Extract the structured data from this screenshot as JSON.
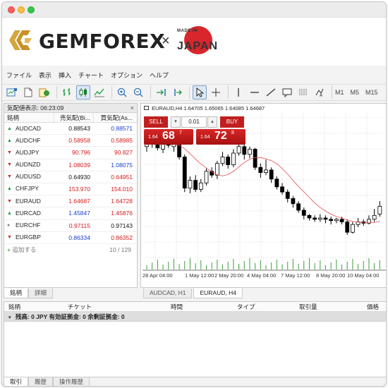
{
  "brand": {
    "name": "GEMFOREX",
    "times": "×",
    "made_in": "MADE IN",
    "country": "JAPAN"
  },
  "menu": [
    "ファイル",
    "表示",
    "挿入",
    "チャート",
    "オプション",
    "ヘルプ"
  ],
  "toolbar": {
    "timeframes": [
      "M1",
      "M5",
      "M15"
    ]
  },
  "market_watch": {
    "title": "気配値表示: 06:23:09",
    "close": "×",
    "headers": {
      "symbol": "銘柄",
      "bid": "売気配(Bi...",
      "ask": "買気配(As..."
    },
    "rows": [
      {
        "symbol": "AUDCAD",
        "dir": "up",
        "bid": "0.88543",
        "ask": "0.88571",
        "bid_color": "black",
        "ask_color": "blue"
      },
      {
        "symbol": "AUDCHF",
        "dir": "up",
        "bid": "0.58958",
        "ask": "0.58985",
        "bid_color": "red",
        "ask_color": "red"
      },
      {
        "symbol": "AUDJPY",
        "dir": "down",
        "bid": "90.796",
        "ask": "90.827",
        "bid_color": "red",
        "ask_color": "red"
      },
      {
        "symbol": "AUDNZD",
        "dir": "down",
        "bid": "1.08039",
        "ask": "1.08075",
        "bid_color": "red",
        "ask_color": "blue"
      },
      {
        "symbol": "AUDUSD",
        "dir": "down",
        "bid": "0.64930",
        "ask": "0.64951",
        "bid_color": "black",
        "ask_color": "red"
      },
      {
        "symbol": "CHFJPY",
        "dir": "up",
        "bid": "153.970",
        "ask": "154.010",
        "bid_color": "red",
        "ask_color": "red"
      },
      {
        "symbol": "EURAUD",
        "dir": "down",
        "bid": "1.64687",
        "ask": "1.64728",
        "bid_color": "red",
        "ask_color": "red"
      },
      {
        "symbol": "EURCAD",
        "dir": "up",
        "bid": "1.45847",
        "ask": "1.45876",
        "bid_color": "blue",
        "ask_color": "red"
      },
      {
        "symbol": "EURCHF",
        "dir": "flat",
        "bid": "0.97115",
        "ask": "0.97143",
        "bid_color": "red",
        "ask_color": "black"
      },
      {
        "symbol": "EURGBP",
        "dir": "down",
        "bid": "0.86334",
        "ask": "0.86352",
        "bid_color": "blue",
        "ask_color": "red"
      }
    ],
    "footer": {
      "add": "追加する",
      "count": "10 / 129"
    },
    "tabs": [
      "銘柄",
      "詳細"
    ]
  },
  "chart": {
    "header": "EURAUD,H4  1.64705 1.65065 1.64085 1.64687",
    "one_click": {
      "sell_label": "SELL",
      "buy_label": "BUY",
      "lot": "0.01",
      "sell_small": "1.64",
      "sell_big": "68",
      "sell_sup": "7",
      "buy_small": "1.64",
      "buy_big": "72",
      "buy_sup": "8"
    },
    "xlabels": [
      "28 Apr 04:00",
      "1 May 12:00",
      "2 May 20:00",
      "4 May 04:00",
      "7 May 12:00",
      "8 May 20:00",
      "10 May 04:00"
    ],
    "tabs": [
      "AUDCAD, H1",
      "EURAUD, H4"
    ]
  },
  "chart_data": {
    "type": "candlestick",
    "title": "EURAUD,H4",
    "xlabel": "",
    "ylabel": "",
    "x_ticks": [
      "28 Apr 04:00",
      "1 May 12:00",
      "2 May 20:00",
      "4 May 04:00",
      "7 May 12:00",
      "8 May 20:00",
      "10 May 04:00"
    ],
    "note": "values are relative price levels (0 = chart low, 100 = chart high)",
    "candles": [
      {
        "o": 80,
        "c": 84,
        "h": 88,
        "l": 76,
        "bull": true
      },
      {
        "o": 84,
        "c": 82,
        "h": 86,
        "l": 79,
        "bull": false
      },
      {
        "o": 82,
        "c": 79,
        "h": 85,
        "l": 77,
        "bull": false
      },
      {
        "o": 78,
        "c": 84,
        "h": 87,
        "l": 75,
        "bull": true
      },
      {
        "o": 84,
        "c": 81,
        "h": 88,
        "l": 79,
        "bull": false
      },
      {
        "o": 80,
        "c": 82,
        "h": 84,
        "l": 76,
        "bull": true
      },
      {
        "o": 82,
        "c": 72,
        "h": 84,
        "l": 70,
        "bull": false
      },
      {
        "o": 72,
        "c": 48,
        "h": 74,
        "l": 45,
        "bull": false
      },
      {
        "o": 48,
        "c": 54,
        "h": 57,
        "l": 44,
        "bull": true
      },
      {
        "o": 54,
        "c": 47,
        "h": 58,
        "l": 45,
        "bull": false
      },
      {
        "o": 47,
        "c": 52,
        "h": 55,
        "l": 45,
        "bull": true
      },
      {
        "o": 52,
        "c": 61,
        "h": 63,
        "l": 50,
        "bull": true
      },
      {
        "o": 61,
        "c": 58,
        "h": 64,
        "l": 56,
        "bull": false
      },
      {
        "o": 58,
        "c": 67,
        "h": 69,
        "l": 55,
        "bull": true
      },
      {
        "o": 67,
        "c": 72,
        "h": 76,
        "l": 65,
        "bull": true
      },
      {
        "o": 72,
        "c": 66,
        "h": 74,
        "l": 63,
        "bull": false
      },
      {
        "o": 66,
        "c": 75,
        "h": 78,
        "l": 64,
        "bull": true
      },
      {
        "o": 75,
        "c": 80,
        "h": 85,
        "l": 73,
        "bull": true
      },
      {
        "o": 80,
        "c": 74,
        "h": 82,
        "l": 70,
        "bull": false
      },
      {
        "o": 74,
        "c": 78,
        "h": 80,
        "l": 71,
        "bull": true
      },
      {
        "o": 78,
        "c": 64,
        "h": 79,
        "l": 62,
        "bull": false
      },
      {
        "o": 64,
        "c": 60,
        "h": 67,
        "l": 56,
        "bull": false
      },
      {
        "o": 60,
        "c": 62,
        "h": 70,
        "l": 58,
        "bull": true
      },
      {
        "o": 62,
        "c": 55,
        "h": 64,
        "l": 52,
        "bull": false
      },
      {
        "o": 55,
        "c": 49,
        "h": 57,
        "l": 47,
        "bull": false
      },
      {
        "o": 49,
        "c": 45,
        "h": 52,
        "l": 43,
        "bull": false
      },
      {
        "o": 45,
        "c": 40,
        "h": 47,
        "l": 37,
        "bull": false
      },
      {
        "o": 40,
        "c": 36,
        "h": 42,
        "l": 33,
        "bull": false
      },
      {
        "o": 36,
        "c": 31,
        "h": 38,
        "l": 29,
        "bull": false
      },
      {
        "o": 31,
        "c": 27,
        "h": 33,
        "l": 24,
        "bull": false
      },
      {
        "o": 27,
        "c": 25,
        "h": 28,
        "l": 23,
        "bull": false
      },
      {
        "o": 25,
        "c": 24,
        "h": 27,
        "l": 22,
        "bull": false
      },
      {
        "o": 24,
        "c": 25,
        "h": 28,
        "l": 22,
        "bull": true
      },
      {
        "o": 25,
        "c": 24,
        "h": 27,
        "l": 21,
        "bull": false
      },
      {
        "o": 24,
        "c": 23,
        "h": 26,
        "l": 20,
        "bull": false
      },
      {
        "o": 23,
        "c": 24,
        "h": 25,
        "l": 21,
        "bull": true
      },
      {
        "o": 24,
        "c": 22,
        "h": 26,
        "l": 20,
        "bull": false
      },
      {
        "o": 22,
        "c": 14,
        "h": 24,
        "l": 12,
        "bull": false
      },
      {
        "o": 14,
        "c": 20,
        "h": 22,
        "l": 13,
        "bull": true
      },
      {
        "o": 20,
        "c": 22,
        "h": 25,
        "l": 18,
        "bull": true
      },
      {
        "o": 22,
        "c": 21,
        "h": 24,
        "l": 19,
        "bull": false
      },
      {
        "o": 21,
        "c": 24,
        "h": 27,
        "l": 20,
        "bull": true
      },
      {
        "o": 24,
        "c": 27,
        "h": 32,
        "l": 22,
        "bull": true
      },
      {
        "o": 28,
        "c": 34,
        "h": 38,
        "l": 26,
        "bull": true
      }
    ]
  },
  "terminal": {
    "headers": [
      "銘柄",
      "チケット",
      "時間",
      "タイプ",
      "取引量",
      "価格"
    ],
    "balance": "残高: 0 JPY  有効証拠金: 0  余剰証拠金: 0",
    "tabs": [
      "取引",
      "履歴",
      "操作履歴"
    ]
  },
  "colors": {
    "bull": "#ffffff",
    "bear": "#000000",
    "ma": "#e84a4a",
    "oneclick": "#c11f1f"
  }
}
